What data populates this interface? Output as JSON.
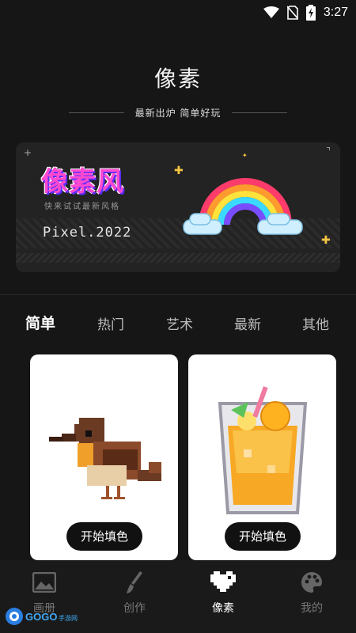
{
  "status_bar": {
    "time": "3:27"
  },
  "header": {
    "title": "像素",
    "subtitle": "最新出炉 简单好玩"
  },
  "banner": {
    "logo_text": "像素风",
    "tagline": "快来试试最新风格",
    "pixel_text": "Pixel.2022"
  },
  "tabs": [
    {
      "label": "简单",
      "active": true
    },
    {
      "label": "热门",
      "active": false
    },
    {
      "label": "艺术",
      "active": false
    },
    {
      "label": "最新",
      "active": false
    },
    {
      "label": "其他",
      "active": false
    }
  ],
  "cards": [
    {
      "button_label": "开始填色",
      "art": "pixel-bird"
    },
    {
      "button_label": "开始填色",
      "art": "pixel-juice-cup"
    }
  ],
  "bottom_nav": [
    {
      "label": "画册",
      "icon": "image-icon",
      "active": false
    },
    {
      "label": "创作",
      "icon": "brush-icon",
      "active": false
    },
    {
      "label": "像素",
      "icon": "pixel-heart-icon",
      "active": true
    },
    {
      "label": "我的",
      "icon": "palette-icon",
      "active": false
    }
  ],
  "watermark": {
    "brand": "GOGO手游网"
  }
}
